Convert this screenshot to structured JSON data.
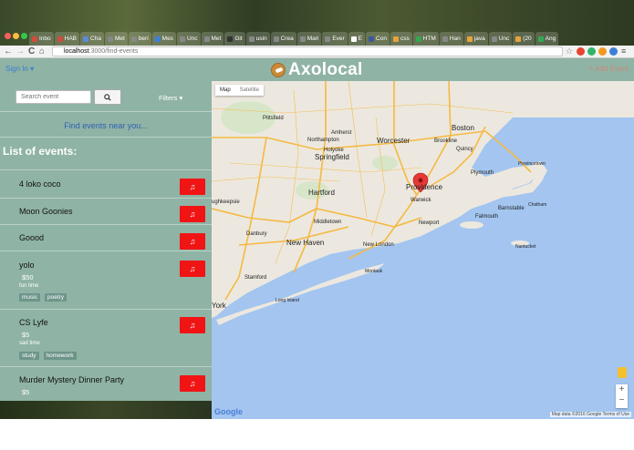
{
  "browser": {
    "tabs": [
      {
        "label": "Inbo",
        "color": "#d34b3b"
      },
      {
        "label": "HAB",
        "color": "#d34b3b"
      },
      {
        "label": "Cha",
        "color": "#5b8ad8"
      },
      {
        "label": "Met",
        "color": "#888888"
      },
      {
        "label": "beri",
        "color": "#888888"
      },
      {
        "label": "Mes",
        "color": "#3b7fd8"
      },
      {
        "label": "Unc",
        "color": "#888888"
      },
      {
        "label": "Met",
        "color": "#888888"
      },
      {
        "label": "Git",
        "color": "#333333"
      },
      {
        "label": "usin",
        "color": "#888888"
      },
      {
        "label": "Crea",
        "color": "#888888"
      },
      {
        "label": "Mari",
        "color": "#888888"
      },
      {
        "label": "Ever",
        "color": "#888888"
      },
      {
        "label": "E",
        "color": "#ffffff"
      },
      {
        "label": "Con",
        "color": "#3b5998"
      },
      {
        "label": "css",
        "color": "#e8a33a"
      },
      {
        "label": "HTM",
        "color": "#33a852"
      },
      {
        "label": "Han",
        "color": "#888888"
      },
      {
        "label": "java",
        "color": "#e8a33a"
      },
      {
        "label": "Unc",
        "color": "#888888"
      },
      {
        "label": "(20",
        "color": "#e8a33a"
      },
      {
        "label": "Ang",
        "color": "#33a852"
      }
    ],
    "url_host": "localhost",
    "url_path": ":3000/find-events",
    "nav": {
      "back": "←",
      "forward": "→",
      "reload": "C",
      "home": "⌂"
    }
  },
  "header": {
    "sign_in": "Sign In ▾",
    "brand": "Axolocal",
    "add_event": "+ Add Event"
  },
  "sidebar": {
    "search_placeholder": "Search event",
    "filters": "Filters ▾",
    "find_near": "Find events near you...",
    "list_title": "List of events:",
    "music_icon": "♫",
    "events": [
      {
        "title": "4 loko coco"
      },
      {
        "title": "Moon Goonies"
      },
      {
        "title": "Goood"
      },
      {
        "title": "yolo",
        "price": "$50",
        "desc": "fun time",
        "tags": [
          "music",
          "poetry"
        ]
      },
      {
        "title": "CS Lyfe",
        "price": "$5",
        "desc": "sad time",
        "tags": [
          "study",
          "homework"
        ]
      },
      {
        "title": "Murder Mystery Dinner Party",
        "price": "$5"
      }
    ]
  },
  "map": {
    "toggle_map": "Map",
    "toggle_satellite": "Satellite",
    "labels": {
      "pittsfield": "Pittsfield",
      "amherst": "Amherst",
      "northampton": "Northampton",
      "holyoke": "Holyoke",
      "springfield": "Springfield",
      "worcester": "Worcester",
      "boston": "Boston",
      "brookline": "Brookline",
      "quincy": "Quincy",
      "plymouth": "Plymouth",
      "provincetown": "Provincetown",
      "providence": "Providence",
      "warwick": "Warwick",
      "hartford": "Hartford",
      "middletown": "Middletown",
      "danbury": "Danbury",
      "new_haven": "New Haven",
      "new_london": "New London",
      "newport": "Newport",
      "barnstable": "Barnstable",
      "falmouth": "Falmouth",
      "chatham": "Chatham",
      "nantucket": "Nantucket",
      "stamford": "Stamford",
      "long_island": "Long Island",
      "montauk": "Montauk",
      "york": "York",
      "poughkeepsie": "ughkeepsie"
    },
    "zoom_in": "+",
    "zoom_out": "−",
    "logo": "Google",
    "attribution": "Map data ©2016 Google   Terms of Use"
  },
  "colors": {
    "sidebar_bg": "#8fb3a5",
    "accent_red": "#f01414",
    "water": "#a3c5f0",
    "land": "#ece8df",
    "highway": "#f5b942",
    "marker": "#e53935"
  }
}
